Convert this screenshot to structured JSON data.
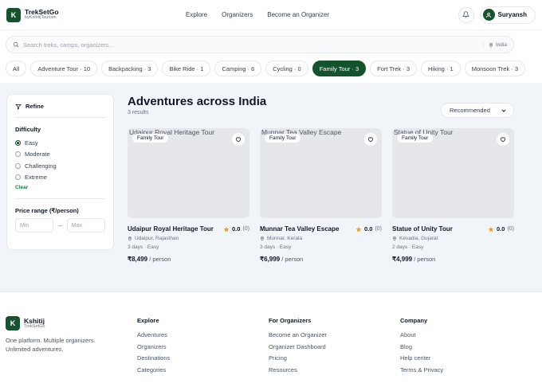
{
  "brand": {
    "name": "TrekSetGo",
    "sub": "byKshitijTourism",
    "mark": "K"
  },
  "nav": [
    "Explore",
    "Organizers",
    "Become an Organizer"
  ],
  "user": {
    "name": "Suryansh"
  },
  "search": {
    "placeholder": "Search treks, camps, organizers...",
    "location": "India"
  },
  "chips": [
    {
      "label": "All",
      "active": false
    },
    {
      "label": "Adventure Tour · 10",
      "active": false
    },
    {
      "label": "Backpacking · 3",
      "active": false
    },
    {
      "label": "Bike Ride · 1",
      "active": false
    },
    {
      "label": "Camping · 6",
      "active": false
    },
    {
      "label": "Cycling · 0",
      "active": false
    },
    {
      "label": "Family Tour · 3",
      "active": true
    },
    {
      "label": "Fort Trek · 3",
      "active": false
    },
    {
      "label": "Hiking · 1",
      "active": false
    },
    {
      "label": "Monsoon Trek · 3",
      "active": false
    }
  ],
  "sidebar": {
    "title": "Refine",
    "difficulty_title": "Difficulty",
    "difficulty": [
      {
        "label": "Easy",
        "selected": true
      },
      {
        "label": "Moderate",
        "selected": false
      },
      {
        "label": "Challenging",
        "selected": false
      },
      {
        "label": "Extreme",
        "selected": false
      }
    ],
    "clear": "Clear",
    "price_title": "Price range (₹/person)",
    "min_placeholder": "Min",
    "max_placeholder": "Max",
    "dash": "–"
  },
  "results": {
    "title": "Adventures across India",
    "count": "3 results",
    "sort": "Recommended"
  },
  "cards": [
    {
      "alt": "Udaipur Royal Heritage Tour",
      "tag": "Family Tour",
      "title": "Udaipur Royal Heritage Tour",
      "rating": "0.0",
      "reviews": "(0)",
      "location": "Udaipur, Rajasthan",
      "duration": "3 days · Easy",
      "price": "₹8,499",
      "per": " / person"
    },
    {
      "alt": "Munnar Tea Valley Escape",
      "tag": "Family Tour",
      "title": "Munnar Tea Valley Escape",
      "rating": "0.0",
      "reviews": "(0)",
      "location": "Munnar, Kerala",
      "duration": "3 days · Easy",
      "price": "₹6,999",
      "per": " / person"
    },
    {
      "alt": "Statue of Unity Tour",
      "tag": "Family Tour",
      "title": "Statue of Unity Tour",
      "rating": "0.0",
      "reviews": "(0)",
      "location": "Kevadia, Gujarat",
      "duration": "2 days · Easy",
      "price": "₹4,999",
      "per": " / person"
    }
  ],
  "footer": {
    "brand": {
      "name": "Kshitij",
      "sub": "TrekSetGo",
      "mark": "K",
      "tagline": "One platform. Multiple organizers. Unlimited adventures."
    },
    "columns": [
      {
        "heading": "Explore",
        "links": [
          "Adventures",
          "Organizers",
          "Destinations",
          "Categories"
        ]
      },
      {
        "heading": "For Organizers",
        "links": [
          "Become an Organizer",
          "Organizer Dashboard",
          "Pricing",
          "Resources"
        ]
      },
      {
        "heading": "Company",
        "links": [
          "About",
          "Blog",
          "Help center",
          "Terms & Privacy"
        ]
      }
    ]
  },
  "colors": {
    "primary": "#14532d",
    "star": "#f59e0b",
    "band": "#f1f5f9"
  }
}
